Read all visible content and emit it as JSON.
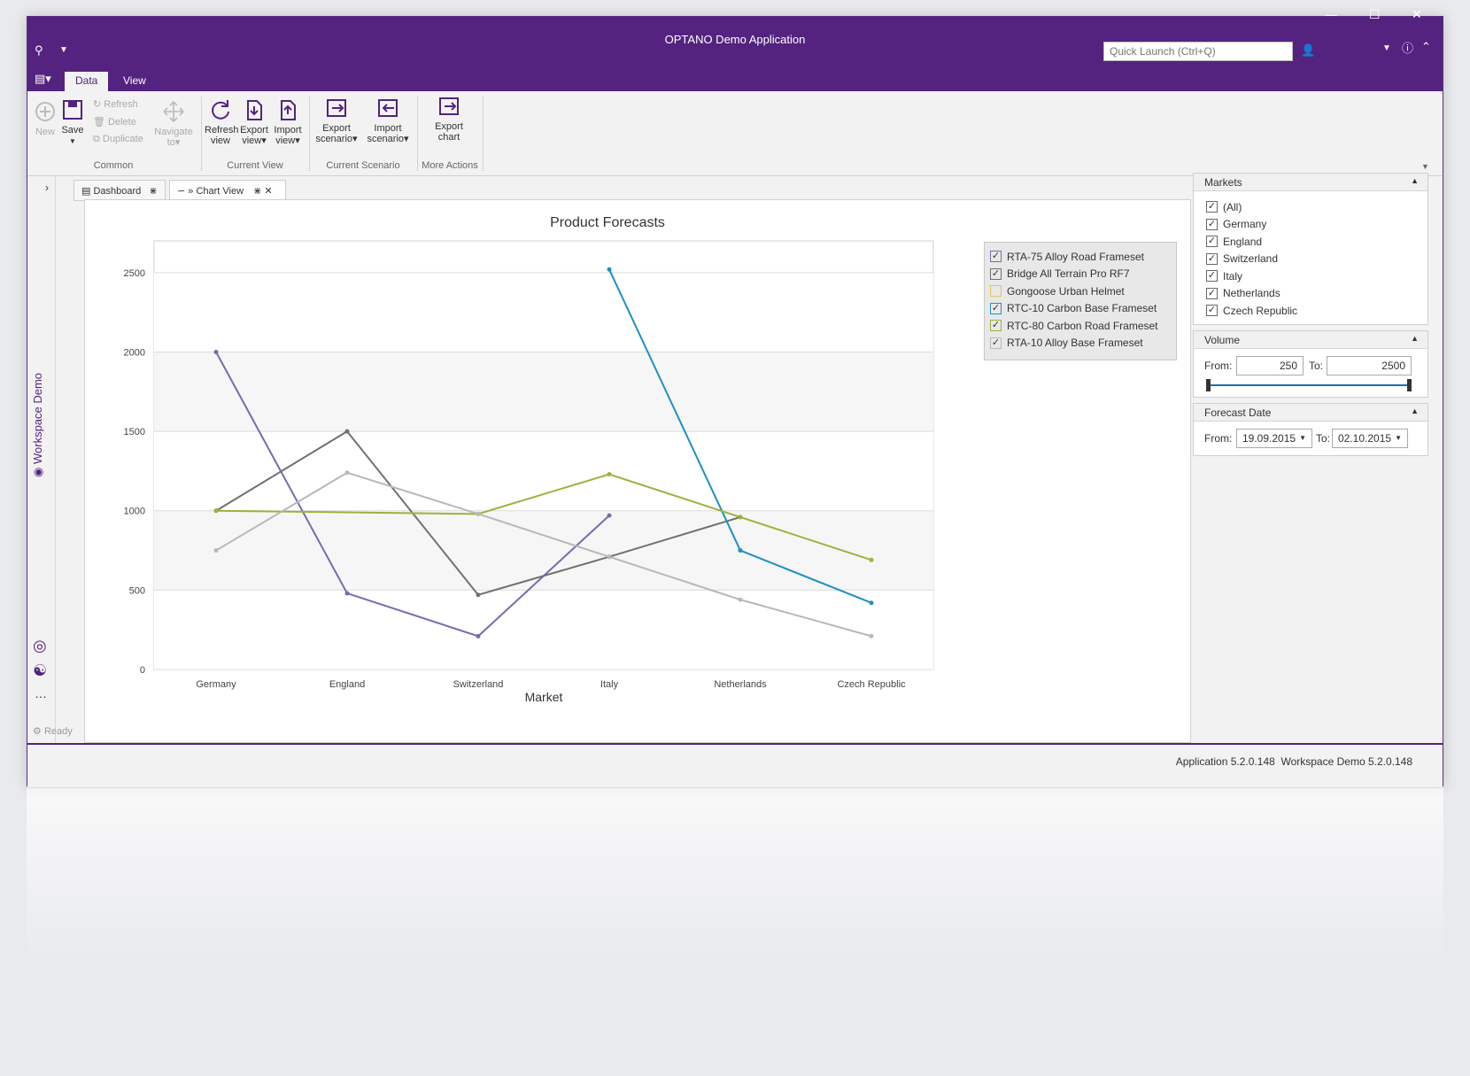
{
  "window": {
    "title": "OPTANO Demo Application",
    "quick_launch_placeholder": "Quick Launch (Ctrl+Q)"
  },
  "ribbon": {
    "tabs": [
      "Data",
      "View"
    ],
    "common": {
      "new": "New",
      "save": "Save",
      "refresh": "Refresh",
      "delete": "Delete",
      "duplicate": "Duplicate",
      "navigate1": "Navigate",
      "navigate2": "to",
      "label": "Common"
    },
    "current_view": {
      "refresh1": "Refresh",
      "refresh2": "view",
      "export1": "Export",
      "export2": "view",
      "import1": "Import",
      "import2": "view",
      "label": "Current View"
    },
    "current_scenario": {
      "export1": "Export",
      "export2": "scenario",
      "import1": "Import",
      "import2": "scenario",
      "label": "Current Scenario"
    },
    "more_actions": {
      "export1": "Export",
      "export2": "chart",
      "label": "More Actions"
    }
  },
  "sidebar": {
    "workspace_label": "Workspace Demo"
  },
  "doc_tabs": {
    "dashboard": "Dashboard",
    "chart_view": "» Chart View"
  },
  "chart_data": {
    "type": "line",
    "title": "Product Forecasts",
    "xlabel": "Market",
    "ylabel": "",
    "categories": [
      "Germany",
      "England",
      "Switzerland",
      "Italy",
      "Netherlands",
      "Czech Republic"
    ],
    "ylim": [
      0,
      2700
    ],
    "yticks": [
      0,
      500,
      1000,
      1500,
      2000,
      2500
    ],
    "series": [
      {
        "name": "RTA-75 Alloy Road Frameset",
        "color": "#7b68b0",
        "values": [
          2000,
          480,
          210,
          970,
          null,
          null
        ]
      },
      {
        "name": "Bridge All Terrain Pro RF7",
        "color": "#707070",
        "values": [
          1000,
          1500,
          470,
          710,
          960,
          null
        ]
      },
      {
        "name": "Gongoose Urban Helmet",
        "color": "#e6c35a",
        "values": [
          null,
          null,
          null,
          null,
          null,
          null
        ]
      },
      {
        "name": "RTC-10 Carbon Base Frameset",
        "color": "#1e8fc4",
        "values": [
          null,
          null,
          null,
          2520,
          750,
          420
        ]
      },
      {
        "name": "RTC-80 Carbon Road Frameset",
        "color": "#9db23c",
        "values": [
          1000,
          null,
          980,
          1230,
          960,
          690
        ]
      },
      {
        "name": "RTA-10 Alloy Base Frameset",
        "color": "#b8b8b8",
        "values": [
          750,
          1240,
          980,
          710,
          440,
          210
        ]
      }
    ],
    "legend_checked": [
      true,
      true,
      false,
      true,
      true,
      true
    ],
    "legend_position": "top-right",
    "grid": true
  },
  "filters": {
    "markets": {
      "header": "Markets",
      "items": [
        "(All)",
        "Germany",
        "England",
        "Switzerland",
        "Italy",
        "Netherlands",
        "Czech Republic"
      ]
    },
    "volume": {
      "header": "Volume",
      "from_label": "From:",
      "from": "250",
      "to_label": "To:",
      "to": "2500"
    },
    "forecast_date": {
      "header": "Forecast Date",
      "from_label": "From:",
      "from": "19.09.2015",
      "to_label": "To:",
      "to": "02.10.2015"
    }
  },
  "status": {
    "ready": "Ready",
    "app_version": "Application 5.2.0.148",
    "workspace_version": "Workspace Demo 5.2.0.148"
  }
}
